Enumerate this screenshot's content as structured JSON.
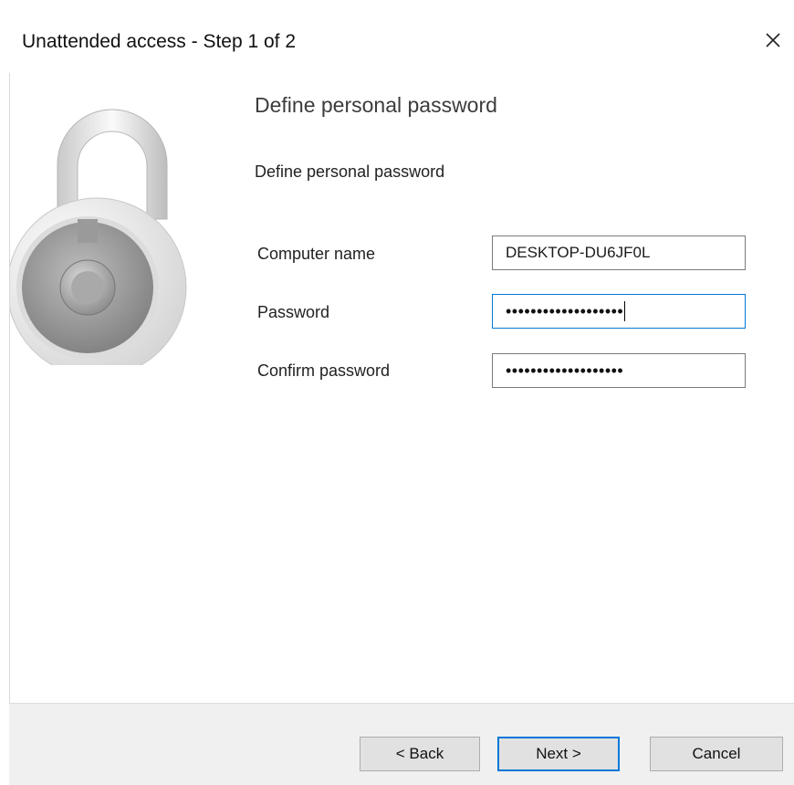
{
  "window": {
    "title": "Unattended access - Step 1 of 2"
  },
  "icons": {
    "close": "close-icon",
    "lock": "padlock-icon"
  },
  "content": {
    "heading": "Define personal password",
    "description": "Define personal password"
  },
  "form": {
    "computer_name_label": "Computer name",
    "computer_name_value": "DESKTOP-DU6JF0L",
    "password_label": "Password",
    "password_masked": "•••••••••••••••••••",
    "confirm_label": "Confirm password",
    "confirm_masked": "•••••••••••••••••••"
  },
  "buttons": {
    "back": "< Back",
    "next": "Next >",
    "cancel": "Cancel"
  },
  "colors": {
    "accent": "#0078d7",
    "footer_bg": "#f0f0f0"
  }
}
